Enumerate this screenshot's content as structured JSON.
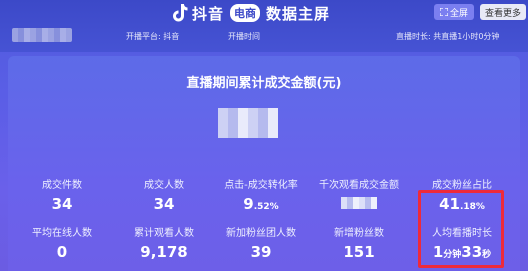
{
  "header": {
    "brand": "抖音",
    "badge": "电商",
    "title": "数据主屏",
    "fullscreen_button": "全屏",
    "more_button": "查看更多",
    "platform_text": "开播平台: 抖音",
    "start_time_text": "开播时间",
    "duration_text": "直播时长: 共直播1小时0分钟"
  },
  "panel": {
    "title": "直播期间累计成交金额(元)"
  },
  "stats_row1": [
    {
      "label": "成交件数",
      "value": "34",
      "suffix": ""
    },
    {
      "label": "成交人数",
      "value": "34",
      "suffix": ""
    },
    {
      "label": "点击-成交转化率",
      "value": "9",
      "suffix": ".52%"
    },
    {
      "label": "千次观看成交金额",
      "value": "",
      "suffix": ""
    },
    {
      "label": "成交粉丝占比",
      "value": "41",
      "suffix": ".18%"
    }
  ],
  "stats_row2": [
    {
      "label": "平均在线人数",
      "value": "0"
    },
    {
      "label": "累计观看人数",
      "value": "9,178"
    },
    {
      "label": "新加粉丝团人数",
      "value": "39"
    },
    {
      "label": "新增粉丝数",
      "value": "151"
    },
    {
      "label": "人均看播时长",
      "value_min": "1",
      "unit_min": "分钟",
      "value_sec": "33",
      "unit_sec": "秒"
    }
  ],
  "colors": {
    "highlight": "#ee2a3a",
    "accent": "#5a5ee6"
  }
}
